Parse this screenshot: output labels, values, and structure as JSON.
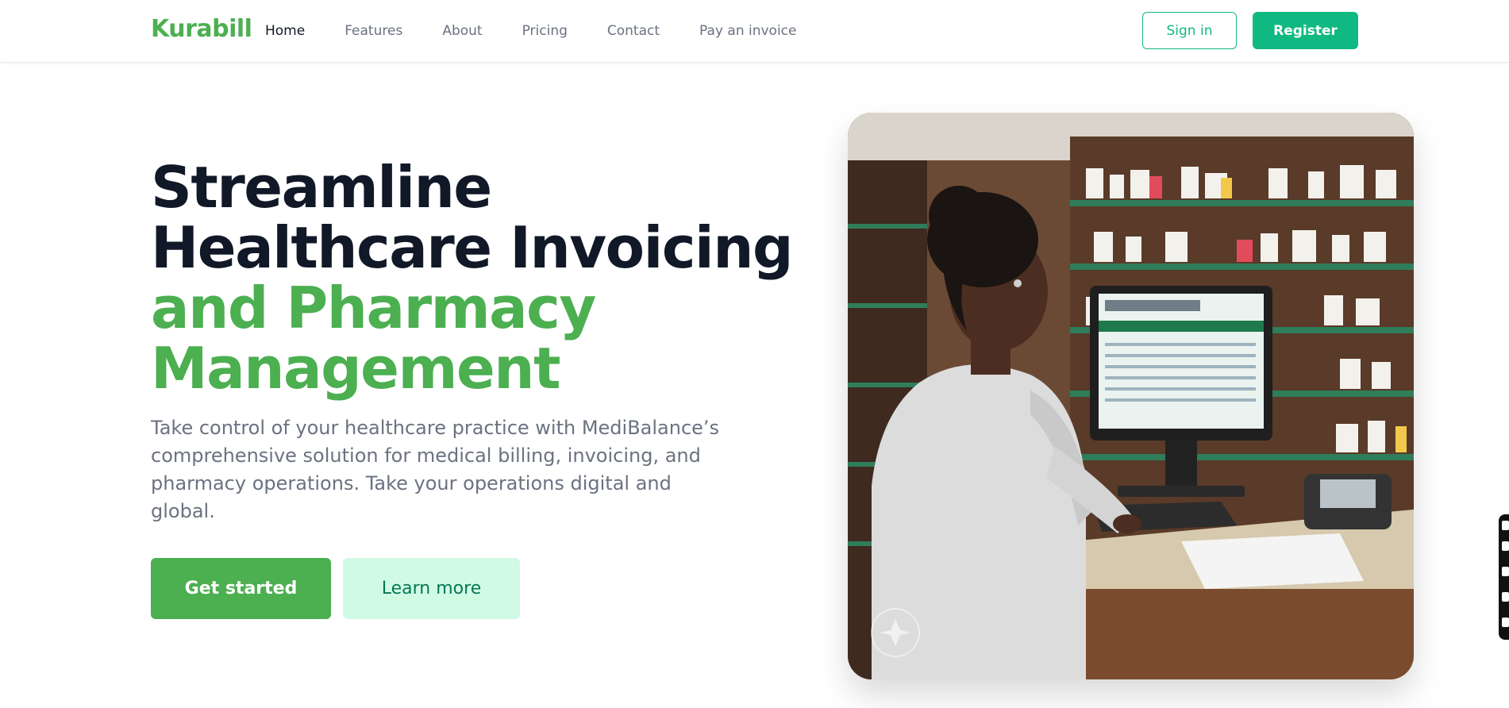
{
  "brand": {
    "name": "Kurabill",
    "color": "#4caf50"
  },
  "nav": {
    "links": [
      {
        "label": "Home",
        "active": true
      },
      {
        "label": "Features",
        "active": false
      },
      {
        "label": "About",
        "active": false
      },
      {
        "label": "Pricing",
        "active": false
      },
      {
        "label": "Contact",
        "active": false
      },
      {
        "label": "Pay an invoice",
        "active": false
      }
    ],
    "signin_label": "Sign in",
    "register_label": "Register"
  },
  "hero": {
    "title_line1": "Streamline",
    "title_line2": "Healthcare Invoicing",
    "title_line3": "and Pharmacy",
    "title_line4": "Management",
    "description": "Take control of your healthcare practice with MediBalance’s comprehensive solution for medical billing, invoicing, and pharmacy operations. Take your operations digital and global.",
    "primary_cta": "Get started",
    "secondary_cta": "Learn more",
    "image_icon": "pharmacist-at-computer-photo"
  },
  "colors": {
    "accent": "#10b981",
    "primary_button": "#4caf50",
    "secondary_button_bg": "#d1fae5",
    "heading": "#111827",
    "body_text": "#6b7280"
  }
}
